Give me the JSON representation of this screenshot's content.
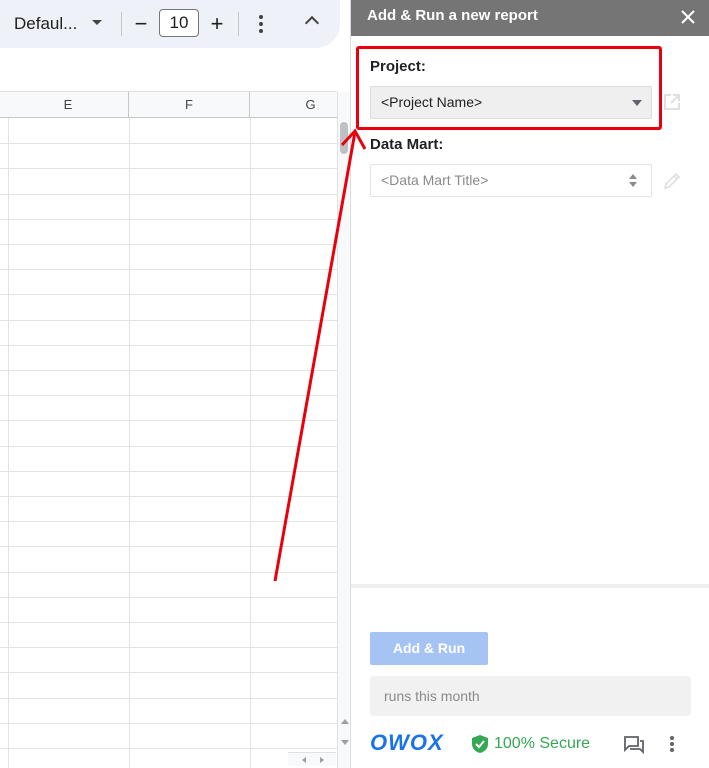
{
  "toolbar": {
    "font_name": "Defaul...",
    "font_size": "10",
    "minus": "−",
    "plus": "+"
  },
  "sheet": {
    "columns": [
      "E",
      "F",
      "G"
    ]
  },
  "panel": {
    "title": "Add & Run a new report",
    "project_label": "Project:",
    "project_value": "<Project Name>",
    "data_mart_label": "Data Mart:",
    "data_mart_placeholder": "<Data Mart Title>",
    "add_run_label": "Add & Run",
    "runs_text": "runs this month",
    "brand": "OWOX",
    "secure_text": "100% Secure"
  },
  "colors": {
    "highlight": "#e8000d",
    "header_bg": "#757575",
    "primary_disabled": "#a6c4f3",
    "brand": "#1a73e8",
    "secure": "#34a853"
  },
  "icons": [
    "chevron-down-icon",
    "kebab-menu-icon",
    "chevron-up-icon",
    "close-icon",
    "open-external-icon",
    "pencil-icon",
    "shield-check-icon",
    "feedback-icon"
  ]
}
